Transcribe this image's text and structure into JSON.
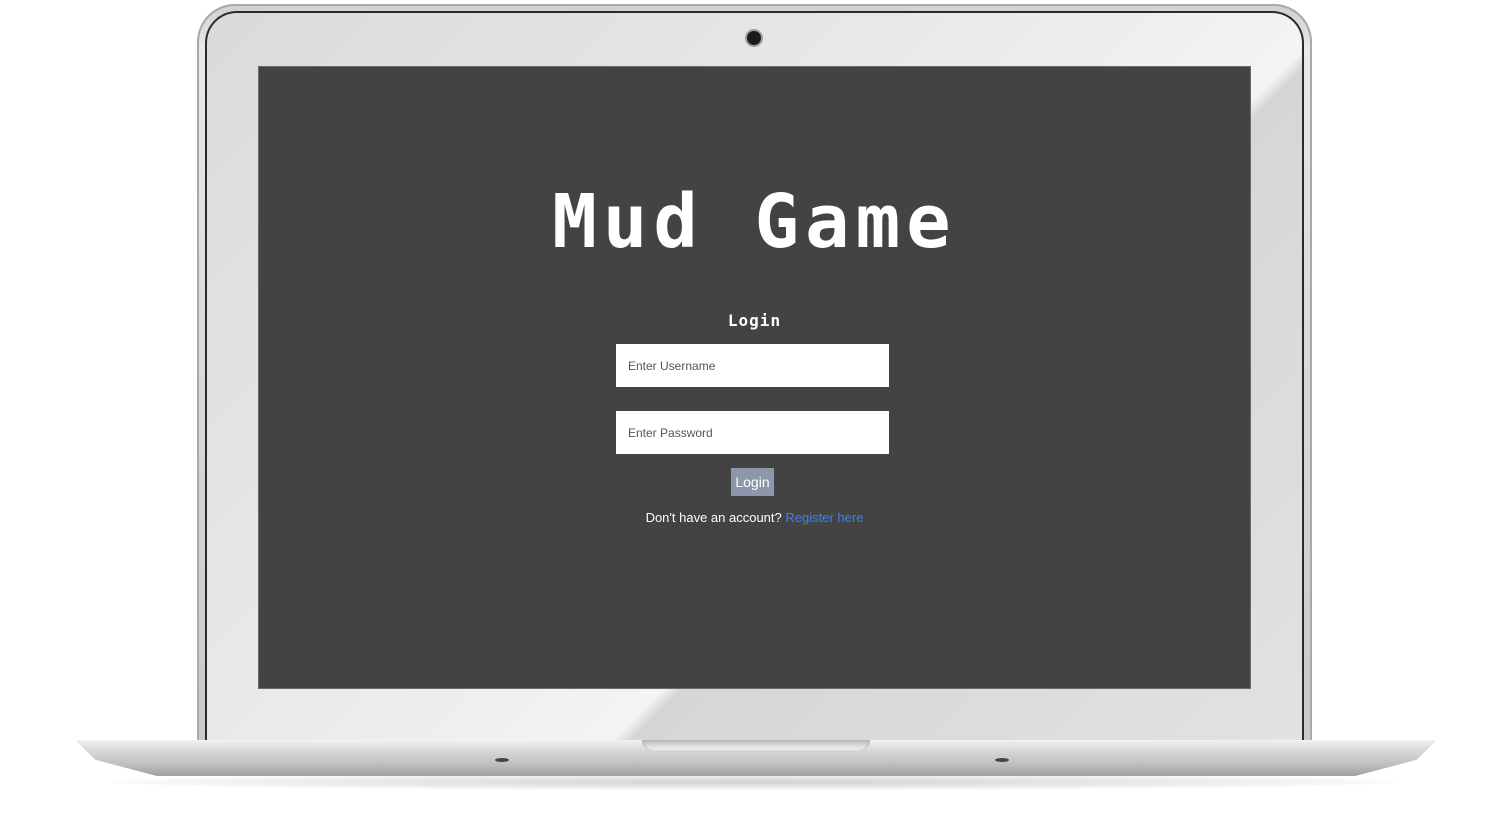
{
  "app": {
    "title": "Mud Game"
  },
  "login": {
    "heading": "Login",
    "username_placeholder": "Enter Username",
    "password_placeholder": "Enter Password",
    "submit_label": "Login",
    "register_prompt": "Don't have an account?",
    "register_link": "Register here"
  },
  "colors": {
    "screen_background": "#434343",
    "button_background": "#8e96ab",
    "link": "#3b82f6",
    "text": "#ffffff"
  }
}
